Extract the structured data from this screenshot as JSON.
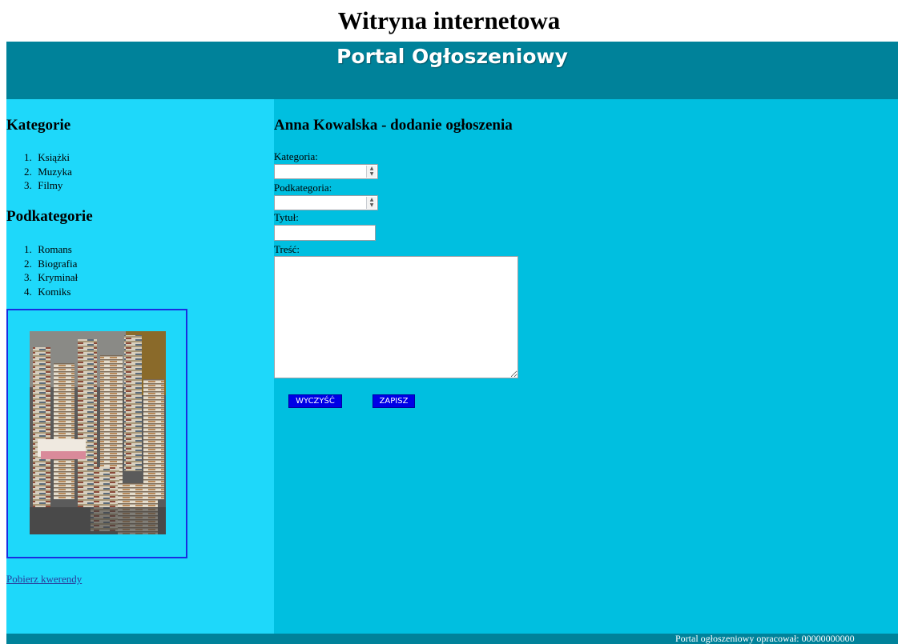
{
  "page_caption": "Witryna internetowa",
  "header": {
    "title": "Portal Ogłoszeniowy"
  },
  "sidebar": {
    "categories_heading": "Kategorie",
    "categories": [
      "Książki",
      "Muzyka",
      "Filmy"
    ],
    "subcategories_heading": "Podkategorie",
    "subcategories": [
      "Romans",
      "Biografia",
      "Kryminał",
      "Komiks"
    ],
    "queries_link": "Pobierz kwerendy"
  },
  "main": {
    "heading": "Anna Kowalska - dodanie ogłoszenia",
    "category_label": "Kategoria:",
    "category_value": "",
    "subcategory_label": "Podkategoria:",
    "subcategory_value": "",
    "title_label": "Tytuł:",
    "title_value": "",
    "content_label": "Treść:",
    "content_value": "",
    "clear_button": "WYCZYŚĆ",
    "save_button": "ZAPISZ"
  },
  "footer": {
    "text": "Portal ogłoszeniowy opracował: 00000000000"
  },
  "colors": {
    "banner": "#00829a",
    "sidebar": "#1ed8fa",
    "main": "#00bfe0",
    "button": "#0000e6",
    "frame_border": "#1a2ee0"
  },
  "icons": {
    "photo": "stacks-of-books-image",
    "spinner": "spinner-arrows-icon"
  }
}
